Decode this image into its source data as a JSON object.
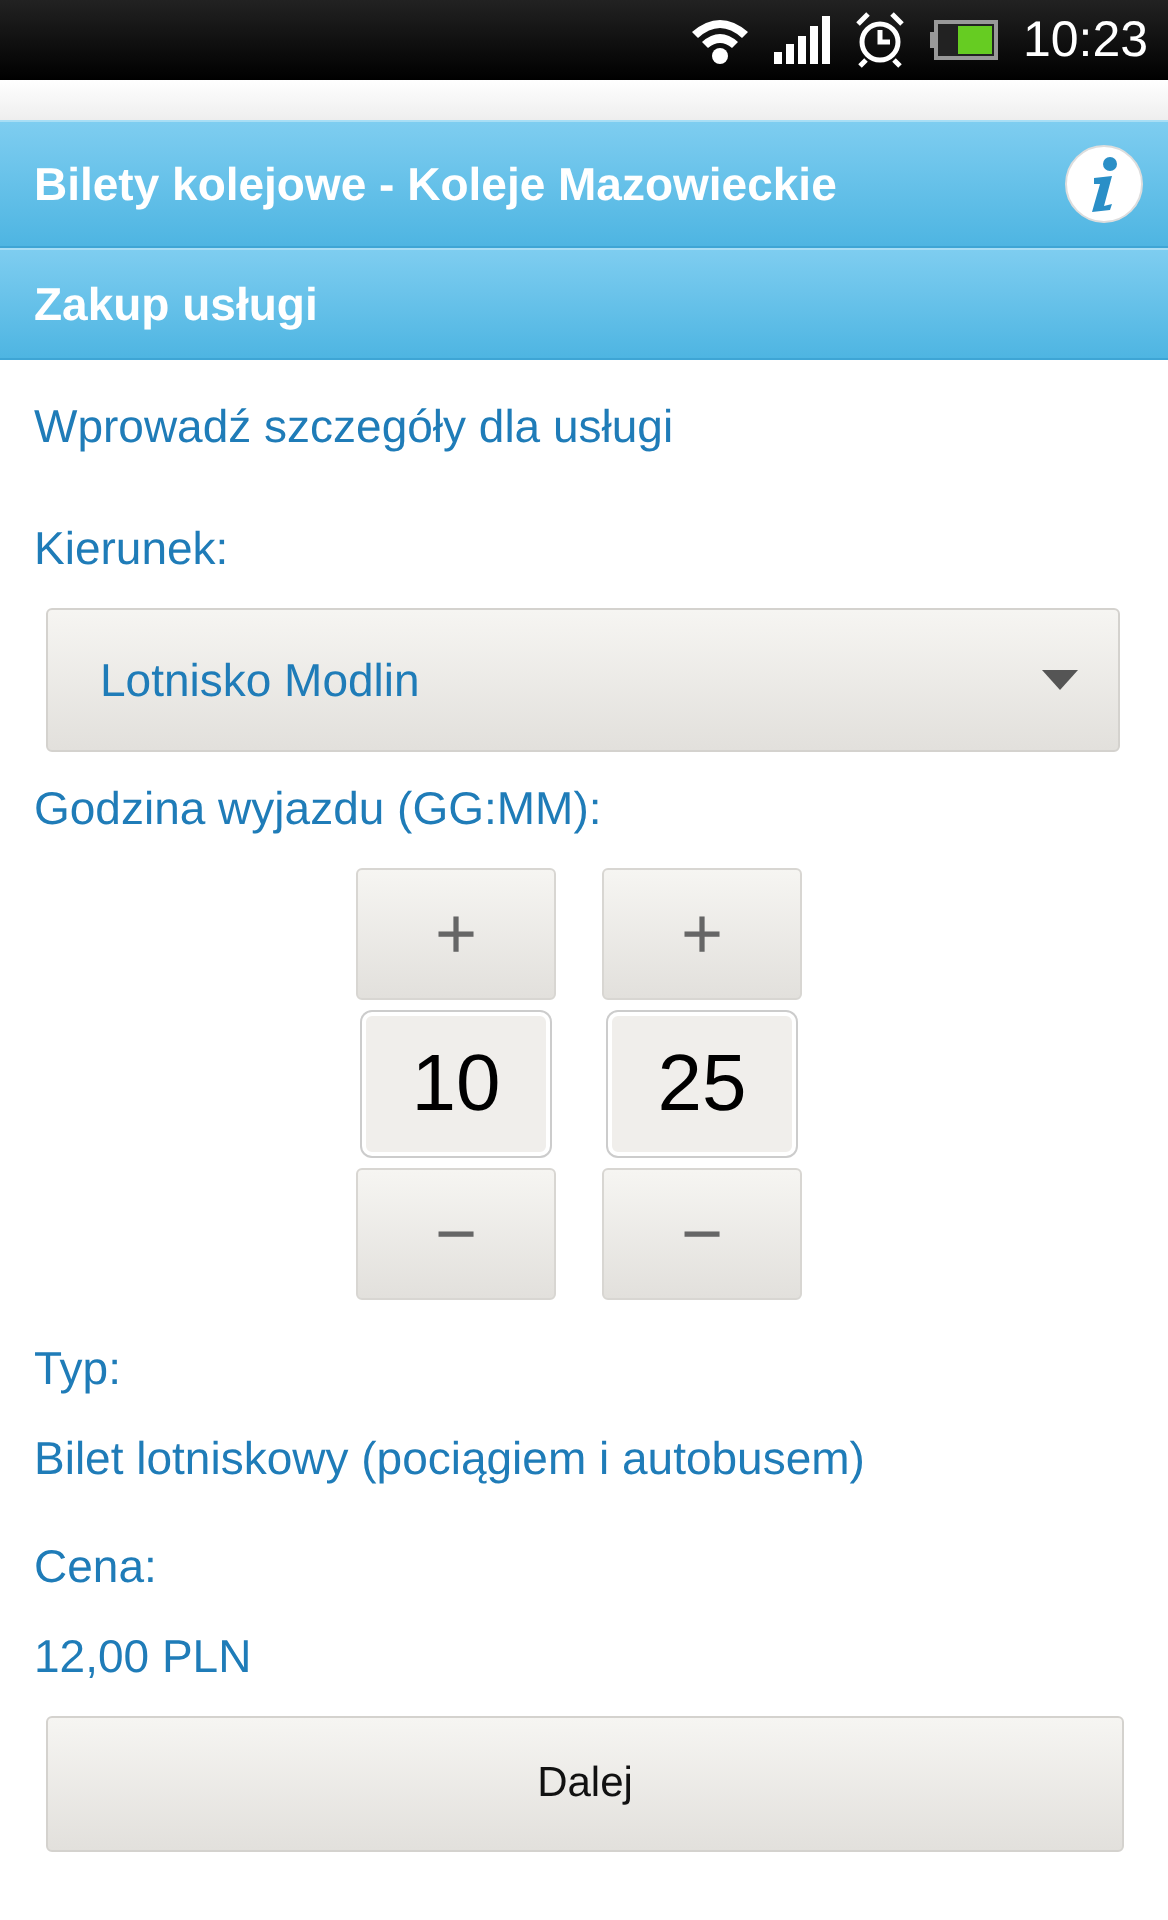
{
  "status_bar": {
    "time": "10:23"
  },
  "header": {
    "title": "Bilety kolejowe - Koleje Mazowieckie"
  },
  "subheader": {
    "title": "Zakup usługi"
  },
  "intro": "Wprowadź szczegóły dla usługi",
  "direction": {
    "label": "Kierunek:",
    "value": "Lotnisko Modlin"
  },
  "departure_time": {
    "label": "Godzina wyjazdu (GG:MM):",
    "spinners": [
      {
        "increment": "+",
        "value": "10",
        "decrement": "−"
      },
      {
        "increment": "+",
        "value": "25",
        "decrement": "−"
      }
    ]
  },
  "type": {
    "label": "Typ:",
    "value": "Bilet lotniskowy (pociągiem i autobusem)"
  },
  "price": {
    "label": "Cena:",
    "value": "12,00 PLN"
  },
  "buttons": [
    "Dalej"
  ]
}
